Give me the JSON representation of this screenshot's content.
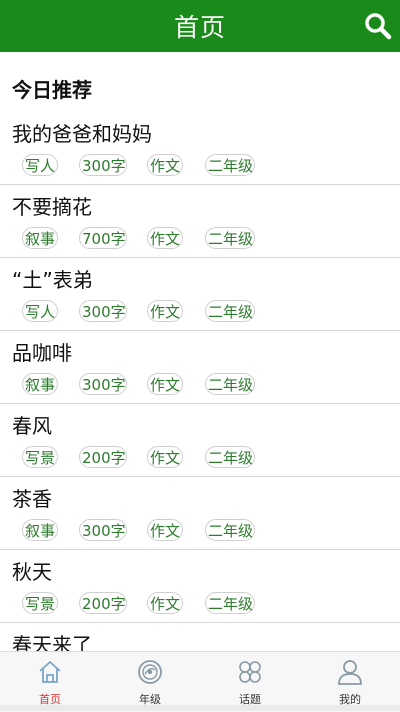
{
  "header": {
    "title": "首页"
  },
  "section": {
    "title": "今日推荐"
  },
  "items": [
    {
      "title": "我的爸爸和妈妈",
      "tags": [
        "写人",
        "300字",
        "作文",
        "二年级"
      ]
    },
    {
      "title": "不要摘花",
      "tags": [
        "叙事",
        "700字",
        "作文",
        "二年级"
      ]
    },
    {
      "title": "“土”表弟",
      "tags": [
        "写人",
        "300字",
        "作文",
        "二年级"
      ]
    },
    {
      "title": "品咖啡",
      "tags": [
        "叙事",
        "300字",
        "作文",
        "二年级"
      ]
    },
    {
      "title": "春风",
      "tags": [
        "写景",
        "200字",
        "作文",
        "二年级"
      ]
    },
    {
      "title": "茶香",
      "tags": [
        "叙事",
        "300字",
        "作文",
        "二年级"
      ]
    },
    {
      "title": "秋天",
      "tags": [
        "写景",
        "200字",
        "作文",
        "二年级"
      ]
    },
    {
      "title": "春天来了",
      "tags": []
    }
  ],
  "tabs": [
    {
      "label": "首页",
      "icon": "home-icon",
      "active": true
    },
    {
      "label": "年级",
      "icon": "disc-icon",
      "active": false
    },
    {
      "label": "话题",
      "icon": "topics-icon",
      "active": false
    },
    {
      "label": "我的",
      "icon": "user-icon",
      "active": false
    }
  ],
  "colors": {
    "header": "#1a8a1a",
    "tag_text": "#2e7d2e",
    "active_tab": "#d33333"
  }
}
